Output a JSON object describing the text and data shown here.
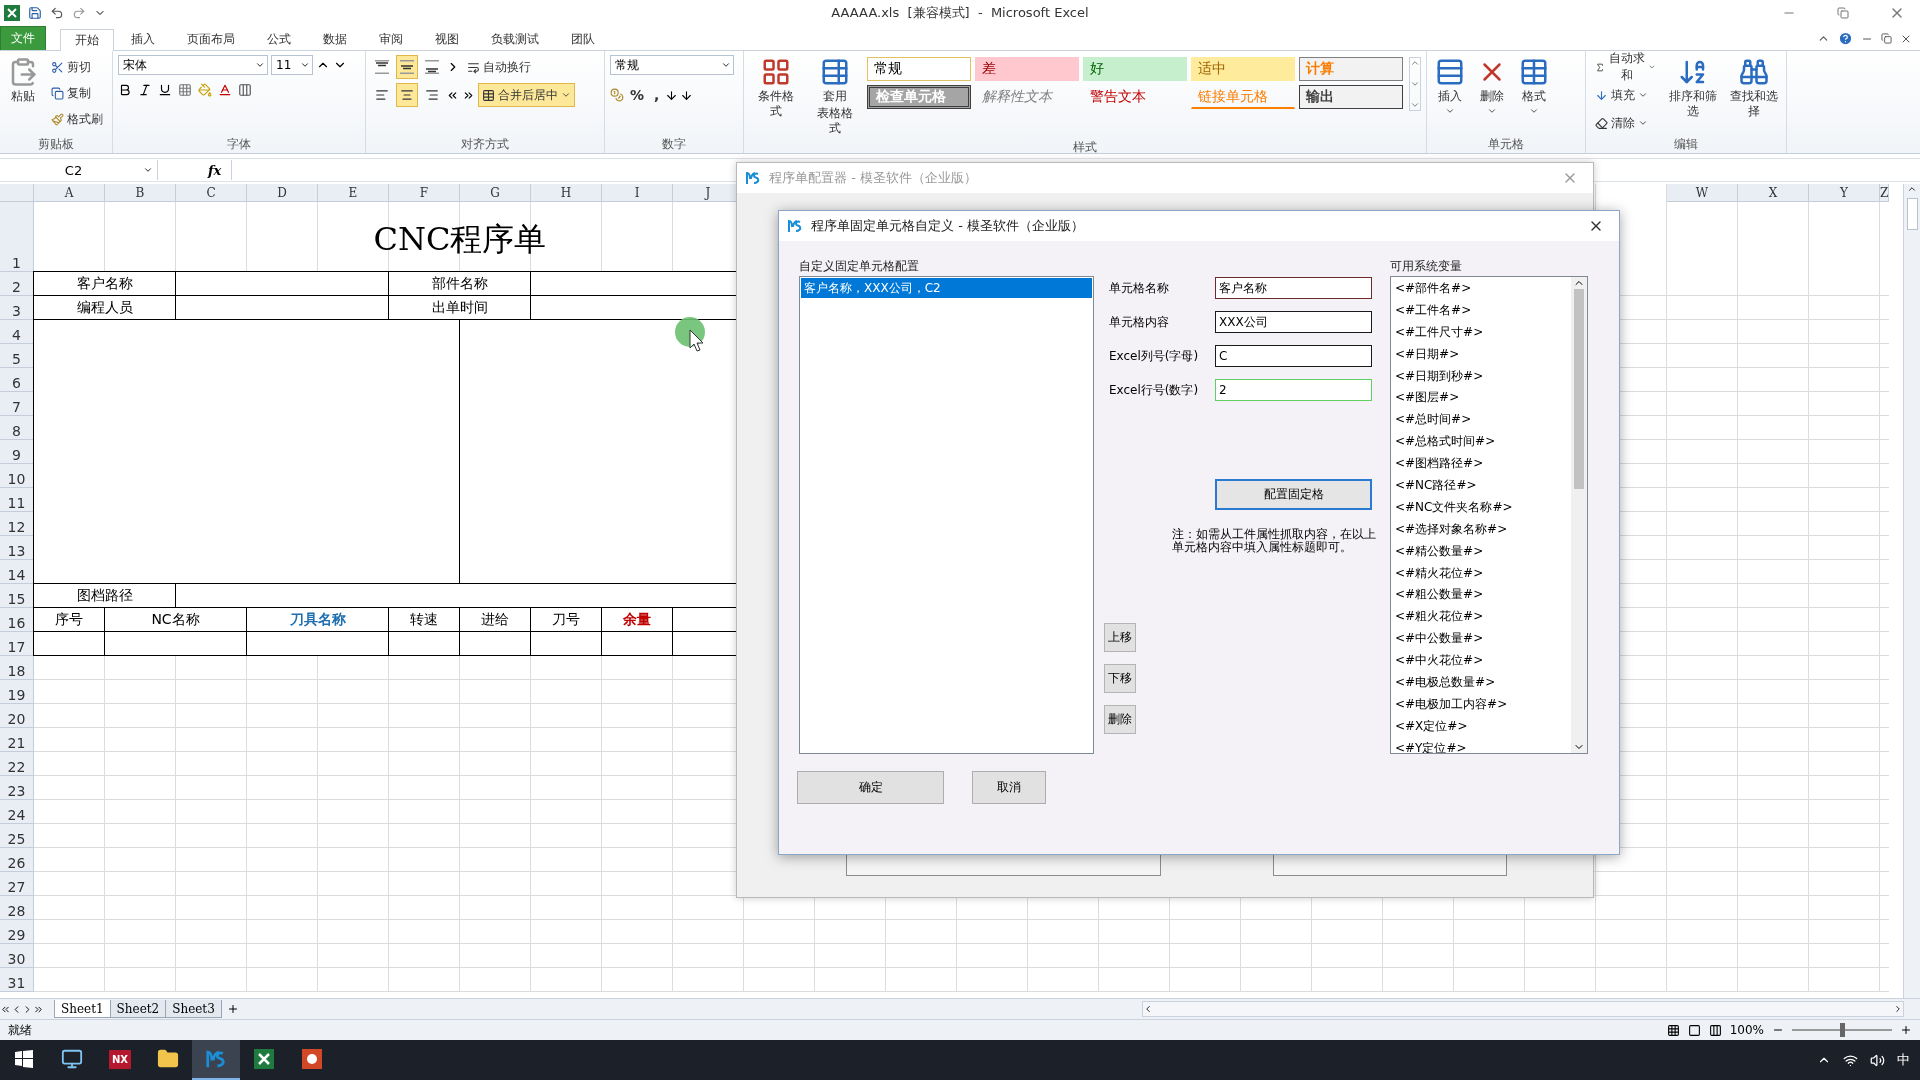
{
  "window": {
    "title": "AAAAA.xls  [兼容模式]  -  Microsoft Excel"
  },
  "ribbon": {
    "tabs": [
      {
        "label": "文件",
        "kind": "file",
        "selected": false
      },
      {
        "label": "开始",
        "kind": "tab",
        "selected": true
      },
      {
        "label": "插入",
        "kind": "tab",
        "selected": false
      },
      {
        "label": "页面布局",
        "kind": "tab",
        "selected": false
      },
      {
        "label": "公式",
        "kind": "tab",
        "selected": false
      },
      {
        "label": "数据",
        "kind": "tab",
        "selected": false
      },
      {
        "label": "审阅",
        "kind": "tab",
        "selected": false
      },
      {
        "label": "视图",
        "kind": "tab",
        "selected": false
      },
      {
        "label": "负载测试",
        "kind": "tab",
        "selected": false
      },
      {
        "label": "团队",
        "kind": "tab",
        "selected": false
      }
    ],
    "clipboard": {
      "paste": "粘贴",
      "cut": "剪切",
      "copy": "复制",
      "format_painter": "格式刷",
      "label": "剪贴板"
    },
    "font": {
      "name": "宋体",
      "size": "11",
      "label": "字体"
    },
    "alignment": {
      "vertical": [
        {
          "on": false
        },
        {
          "on": true
        },
        {
          "on": false
        }
      ],
      "horizontal": [
        {
          "on": false
        },
        {
          "on": true
        },
        {
          "on": false
        }
      ],
      "wrap": {
        "label": "自动换行",
        "on": false
      },
      "merge": {
        "label": "合并后居中",
        "on": true
      },
      "label": "对齐方式"
    },
    "number": {
      "format": "常规",
      "percent": "%",
      "comma": ",",
      "label": "数字"
    },
    "styles": {
      "conditional": "条件格式",
      "table_format": [
        "套用",
        "表格格式"
      ],
      "label": "样式",
      "gallery": [
        {
          "label": "常规",
          "kind": "normal"
        },
        {
          "label": "差",
          "kind": "bad"
        },
        {
          "label": "好",
          "kind": "good"
        },
        {
          "label": "适中",
          "kind": "neutral"
        },
        {
          "label": "计算",
          "kind": "calc"
        },
        {
          "label": "检查单元格",
          "kind": "check"
        },
        {
          "label": "解释性文本",
          "kind": "explanatory"
        },
        {
          "label": "警告文本",
          "kind": "warning"
        },
        {
          "label": "链接单元格",
          "kind": "linked"
        },
        {
          "label": "输出",
          "kind": "output"
        }
      ]
    },
    "cells": {
      "buttons": [
        "插入",
        "删除",
        "格式"
      ],
      "label": "单元格"
    },
    "editing": {
      "autosum": "自动求和",
      "fill": "填充",
      "clear": "清除",
      "sort": "排序和筛选",
      "find": "查找和选择",
      "label": "编辑"
    }
  },
  "formula_bar": {
    "name_box": "C2",
    "fx": "fx"
  },
  "sheet": {
    "columns": [
      "A",
      "B",
      "C",
      "D",
      "E",
      "F",
      "G",
      "H",
      "I",
      "J",
      "W",
      "X",
      "Y",
      "Z"
    ],
    "rows": [
      "1",
      "2",
      "3",
      "4",
      "5",
      "6",
      "7",
      "8",
      "9",
      "10",
      "11",
      "12",
      "13",
      "14",
      "15",
      "16",
      "17",
      "18",
      "19",
      "20",
      "21",
      "22",
      "23",
      "24",
      "25",
      "26",
      "27",
      "28",
      "29",
      "30",
      "31"
    ],
    "form": {
      "title": "CNC程序单",
      "fields": [
        "客户名称",
        "部件名称",
        "编程人员",
        "出单时间"
      ],
      "path_label": "图档路径",
      "headers": [
        {
          "text": "序号",
          "color": "#000000",
          "bold": false
        },
        {
          "text": "NC名称",
          "color": "#000000",
          "bold": false
        },
        {
          "text": "刀具名称",
          "color": "#1f6fb0",
          "bold": true
        },
        {
          "text": "转速",
          "color": "#000000",
          "bold": false
        },
        {
          "text": "进给",
          "color": "#000000",
          "bold": false
        },
        {
          "text": "刀号",
          "color": "#000000",
          "bold": false
        },
        {
          "text": "余量",
          "color": "#c00000",
          "bold": true
        }
      ]
    },
    "tabs": [
      {
        "label": "Sheet1",
        "selected": true
      },
      {
        "label": "Sheet2",
        "selected": false
      },
      {
        "label": "Sheet3",
        "selected": false
      }
    ]
  },
  "status_bar": {
    "text": "就绪",
    "zoom": "100%",
    "level": 0.5
  },
  "back_dialog": {
    "title": "程序单配置器 - 模圣软件（企业版）"
  },
  "dialog": {
    "title": "程序单固定单元格自定义 - 模圣软件（企业版）",
    "config_label": "自定义固定单元格配置",
    "entries": [
      {
        "text": "客户名称，XXX公司，C2",
        "selected": true
      }
    ],
    "fields": [
      {
        "label": "单元格名称",
        "value": "客户名称",
        "focused": true,
        "hovered": false
      },
      {
        "label": "单元格内容",
        "value": "XXX公司",
        "focused": false,
        "hovered": false
      },
      {
        "label": "Excel列号(字母)",
        "value": "C",
        "focused": false,
        "hovered": false
      },
      {
        "label": "Excel行号(数字)",
        "value": "2",
        "focused": false,
        "hovered": true
      }
    ],
    "configure_button": "配置固定格",
    "note": "注：如需从工件属性抓取内容，在以上单元格内容中填入属性标题即可。",
    "side_buttons": [
      "上移",
      "下移",
      "删除"
    ],
    "variables_label": "可用系统变量",
    "variables": [
      "<#部件名#>",
      "<#工件名#>",
      "<#工件尺寸#>",
      "<#日期#>",
      "<#日期到秒#>",
      "<#图层#>",
      "<#总时间#>",
      "<#总格式时间#>",
      "<#图档路径#>",
      "<#NC路径#>",
      "<#NC文件夹名称#>",
      "<#选择对象名称#>",
      "<#精公数量#>",
      "<#精火花位#>",
      "<#粗公数量#>",
      "<#粗火花位#>",
      "<#中公数量#>",
      "<#中火花位#>",
      "<#电极总数量#>",
      "<#电极加工内容#>",
      "<#X定位#>",
      "<#Y定位#>"
    ],
    "ok": "确定",
    "cancel": "取消"
  },
  "taskbar": {
    "apps": [
      {
        "kind": "computer",
        "selected": false
      },
      {
        "kind": "nx",
        "label": "NX",
        "selected": false
      },
      {
        "kind": "folder",
        "selected": false
      },
      {
        "kind": "ms",
        "selected": true
      },
      {
        "kind": "excel",
        "selected": false
      },
      {
        "kind": "powerpoint",
        "selected": false
      }
    ],
    "ime": "中"
  }
}
